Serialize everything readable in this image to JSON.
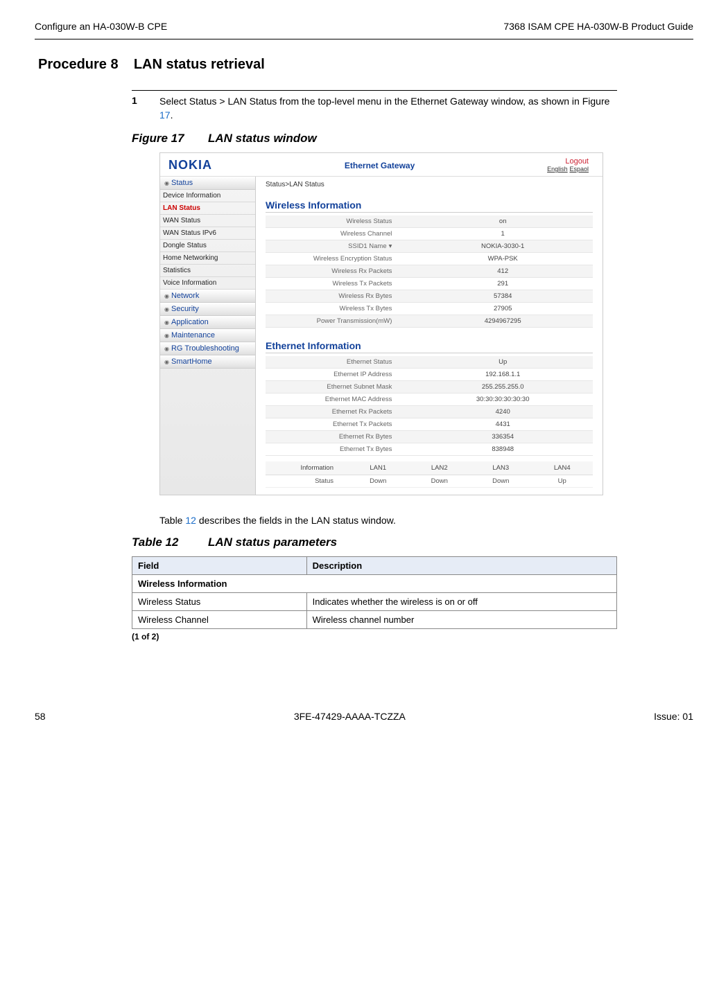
{
  "header": {
    "left": "Configure an HA-030W-B CPE",
    "right": "7368 ISAM CPE HA-030W-B Product Guide"
  },
  "procedure": {
    "number": "Procedure 8",
    "title": "LAN status retrieval"
  },
  "step": {
    "num": "1",
    "text_a": "Select Status > LAN Status from the top-level menu in the Ethernet Gateway window, as shown in Figure ",
    "link": "17",
    "text_b": "."
  },
  "figure": {
    "num": "Figure 17",
    "title": "LAN status window"
  },
  "ss": {
    "logo": "NOKIA",
    "gateway": "Ethernet Gateway",
    "logout": "Logout",
    "lang_en": "English",
    "lang_es": "Espaol",
    "breadcrumb": "Status>LAN Status",
    "sidebar": {
      "status": "Status",
      "items": [
        "Device Information",
        "LAN Status",
        "WAN Status",
        "WAN Status IPv6",
        "Dongle Status",
        "Home Networking",
        "Statistics",
        "Voice Information"
      ],
      "heads": [
        "Network",
        "Security",
        "Application",
        "Maintenance",
        "RG Troubleshooting",
        "SmartHome"
      ]
    },
    "wireless": {
      "title": "Wireless Information",
      "rows": [
        [
          "Wireless Status",
          "on"
        ],
        [
          "Wireless Channel",
          "1"
        ],
        [
          "SSID1 Name",
          "NOKIA-3030-1"
        ],
        [
          "Wireless Encryption Status",
          "WPA-PSK"
        ],
        [
          "Wireless Rx Packets",
          "412"
        ],
        [
          "Wireless Tx Packets",
          "291"
        ],
        [
          "Wireless Rx Bytes",
          "57384"
        ],
        [
          "Wireless Tx Bytes",
          "27905"
        ],
        [
          "Power Transmission(mW)",
          "4294967295"
        ]
      ]
    },
    "ethernet": {
      "title": "Ethernet Information",
      "rows": [
        [
          "Ethernet Status",
          "Up"
        ],
        [
          "Ethernet IP Address",
          "192.168.1.1"
        ],
        [
          "Ethernet Subnet Mask",
          "255.255.255.0"
        ],
        [
          "Ethernet MAC Address",
          "30:30:30:30:30:30"
        ],
        [
          "Ethernet Rx Packets",
          "4240"
        ],
        [
          "Ethernet Tx Packets",
          "4431"
        ],
        [
          "Ethernet Rx Bytes",
          "336354"
        ],
        [
          "Ethernet Tx Bytes",
          "838948"
        ]
      ]
    },
    "lan": {
      "headers": [
        "Information",
        "LAN1",
        "LAN2",
        "LAN3",
        "LAN4"
      ],
      "row_label": "Status",
      "row": [
        "Down",
        "Down",
        "Down",
        "Up"
      ]
    }
  },
  "table_desc": {
    "a": "Table ",
    "link": "12",
    "b": " describes the fields in the LAN status window."
  },
  "table": {
    "num": "Table 12",
    "title": "LAN status parameters",
    "h1": "Field",
    "h2": "Description",
    "sub": "Wireless Information",
    "r1": [
      "Wireless Status",
      "Indicates whether the wireless is on or off"
    ],
    "r2": [
      "Wireless Channel",
      "Wireless channel number"
    ],
    "pagecount": "(1 of 2)"
  },
  "footer": {
    "page": "58",
    "docid": "3FE-47429-AAAA-TCZZA",
    "issue": "Issue: 01"
  }
}
